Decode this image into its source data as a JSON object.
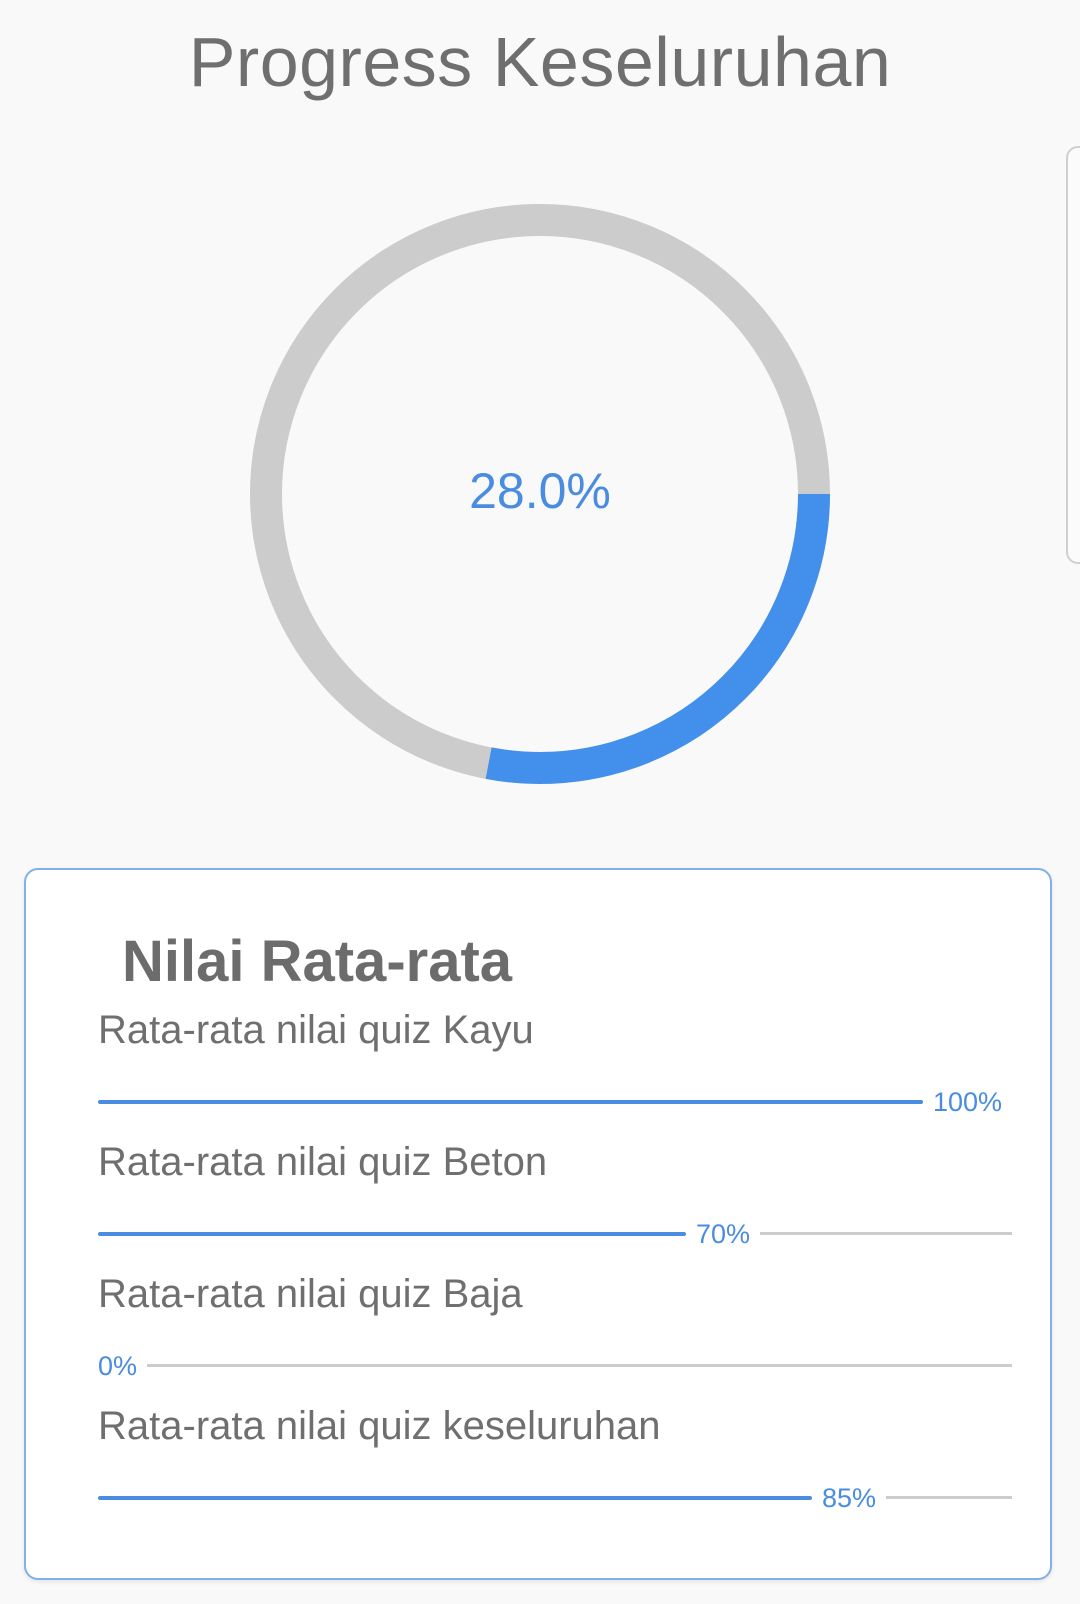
{
  "page": {
    "title": "Progress Keseluruhan"
  },
  "progress": {
    "value": 28.0,
    "label": "28.0%",
    "accent_color": "#4390ec",
    "track_color": "#cccccc"
  },
  "card": {
    "title": "Nilai Rata-rata",
    "items": [
      {
        "label": "Rata-rata nilai quiz Kayu",
        "value": 100,
        "value_label": "100%"
      },
      {
        "label": "Rata-rata nilai quiz Beton",
        "value": 70,
        "value_label": "70%"
      },
      {
        "label": "Rata-rata nilai quiz Baja",
        "value": 0,
        "value_label": "0%"
      },
      {
        "label": "Rata-rata nilai quiz keseluruhan",
        "value": 85,
        "value_label": "85%"
      }
    ]
  }
}
